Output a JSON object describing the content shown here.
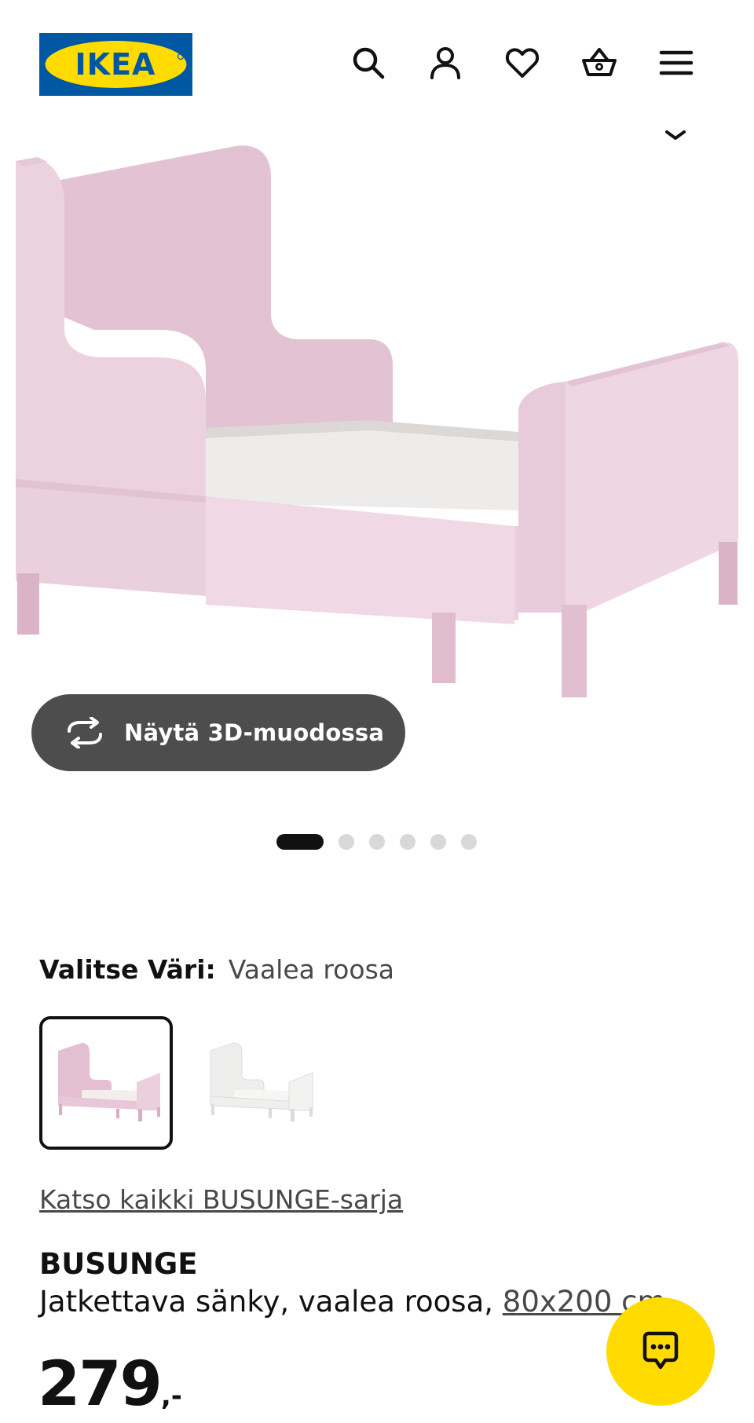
{
  "header": {
    "logo_text": "IKEA",
    "icons": [
      "search-icon",
      "account-icon",
      "heart-icon",
      "basket-icon",
      "menu-icon"
    ]
  },
  "media": {
    "view_3d_label": "Näytä 3D-muodossa",
    "image_count": 6,
    "active_image": 1
  },
  "color_selector": {
    "label": "Valitse Väri:",
    "selected_value": "Vaalea roosa",
    "swatches": [
      "light-pink",
      "white"
    ]
  },
  "series_link": "Katso kaikki BUSUNGE-sarja",
  "product": {
    "name": "BUSUNGE",
    "description": "Jatkettava sänky, vaalea roosa, ",
    "size": "80x200 cm",
    "price_integer": "279",
    "price_suffix": ",-"
  },
  "colors": {
    "brand_blue": "#0058a3",
    "brand_yellow": "#ffdb00",
    "bed_pink": "#e8cfdc",
    "button_dark": "#4d4d4d"
  }
}
